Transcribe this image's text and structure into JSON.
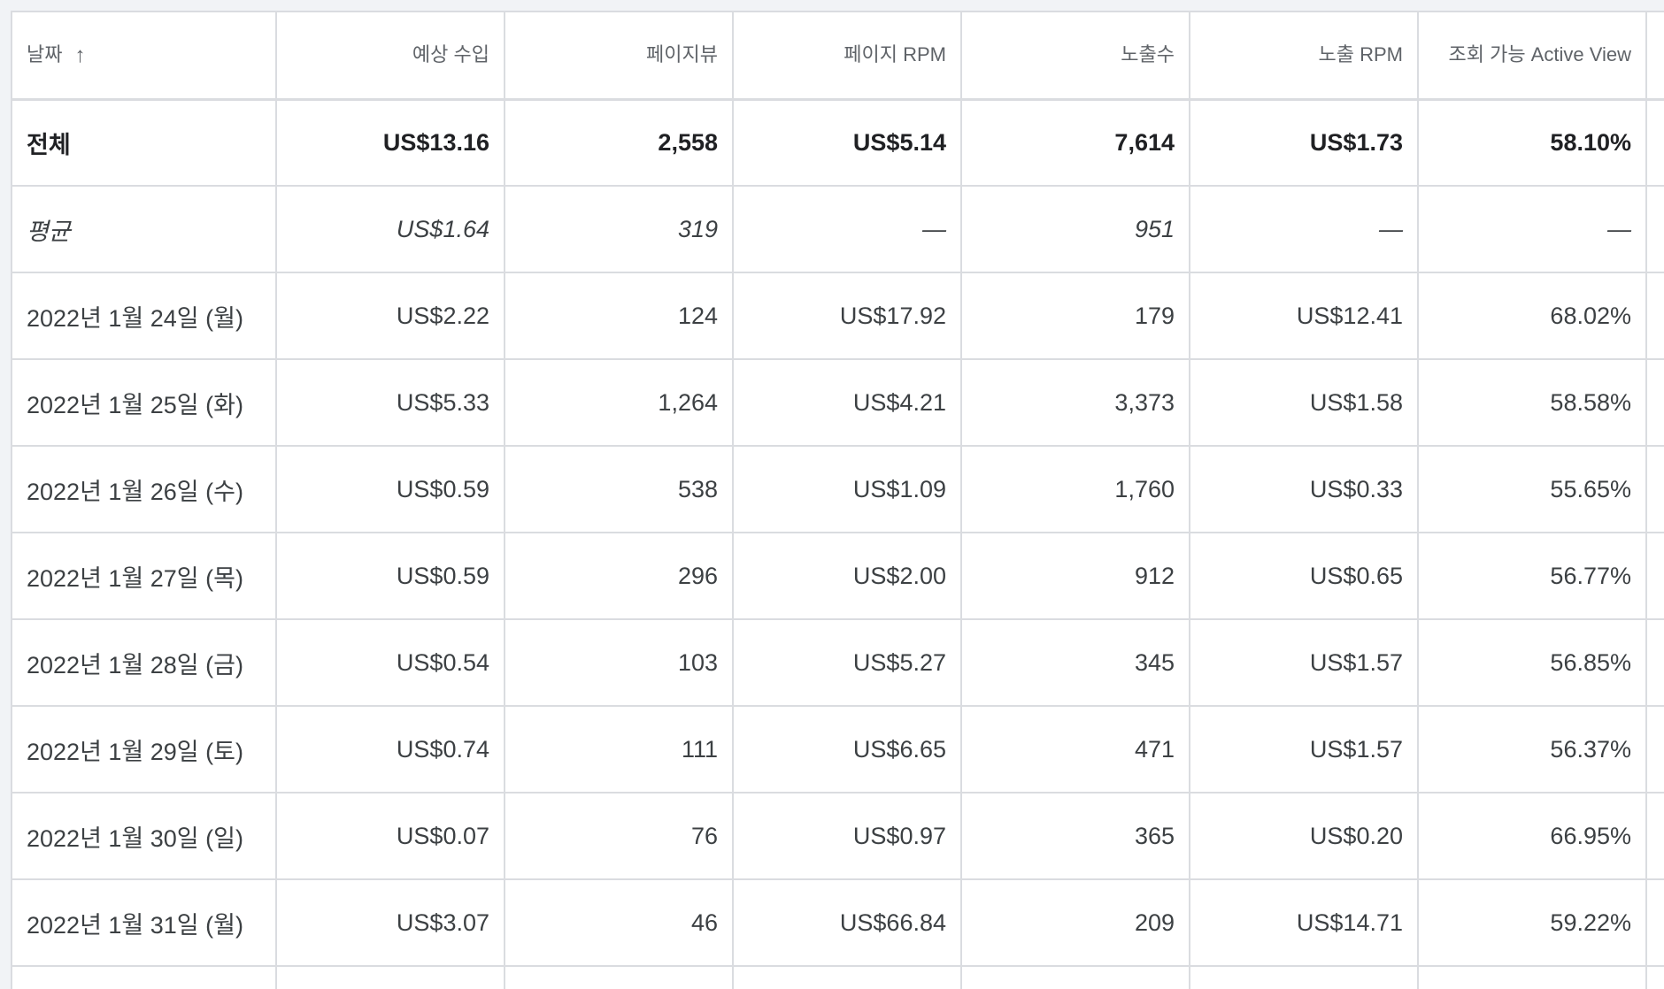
{
  "columns": [
    {
      "key": "date",
      "label": "날짜",
      "sorted": "asc",
      "sort_icon": "arrow-up-icon",
      "sort_glyph": "↑"
    },
    {
      "key": "revenue",
      "label": "예상 수입"
    },
    {
      "key": "pageviews",
      "label": "페이지뷰"
    },
    {
      "key": "page_rpm",
      "label": "페이지 RPM"
    },
    {
      "key": "impressions",
      "label": "노출수"
    },
    {
      "key": "impression_rpm",
      "label": "노출 RPM"
    },
    {
      "key": "active_view",
      "label": "조회 가능 Active View"
    }
  ],
  "total": {
    "date": "전체",
    "revenue": "US$13.16",
    "pageviews": "2,558",
    "page_rpm": "US$5.14",
    "impressions": "7,614",
    "impression_rpm": "US$1.73",
    "active_view": "58.10%"
  },
  "average": {
    "date": "평균",
    "revenue": "US$1.64",
    "pageviews": "319",
    "page_rpm": "—",
    "impressions": "951",
    "impression_rpm": "—",
    "active_view": "—"
  },
  "rows": [
    {
      "date": "2022년 1월 24일 (월)",
      "revenue": "US$2.22",
      "pageviews": "124",
      "page_rpm": "US$17.92",
      "impressions": "179",
      "impression_rpm": "US$12.41",
      "active_view": "68.02%"
    },
    {
      "date": "2022년 1월 25일 (화)",
      "revenue": "US$5.33",
      "pageviews": "1,264",
      "page_rpm": "US$4.21",
      "impressions": "3,373",
      "impression_rpm": "US$1.58",
      "active_view": "58.58%"
    },
    {
      "date": "2022년 1월 26일 (수)",
      "revenue": "US$0.59",
      "pageviews": "538",
      "page_rpm": "US$1.09",
      "impressions": "1,760",
      "impression_rpm": "US$0.33",
      "active_view": "55.65%"
    },
    {
      "date": "2022년 1월 27일 (목)",
      "revenue": "US$0.59",
      "pageviews": "296",
      "page_rpm": "US$2.00",
      "impressions": "912",
      "impression_rpm": "US$0.65",
      "active_view": "56.77%"
    },
    {
      "date": "2022년 1월 28일 (금)",
      "revenue": "US$0.54",
      "pageviews": "103",
      "page_rpm": "US$5.27",
      "impressions": "345",
      "impression_rpm": "US$1.57",
      "active_view": "56.85%"
    },
    {
      "date": "2022년 1월 29일 (토)",
      "revenue": "US$0.74",
      "pageviews": "111",
      "page_rpm": "US$6.65",
      "impressions": "471",
      "impression_rpm": "US$1.57",
      "active_view": "56.37%"
    },
    {
      "date": "2022년 1월 30일 (일)",
      "revenue": "US$0.07",
      "pageviews": "76",
      "page_rpm": "US$0.97",
      "impressions": "365",
      "impression_rpm": "US$0.20",
      "active_view": "66.95%"
    },
    {
      "date": "2022년 1월 31일 (월)",
      "revenue": "US$3.07",
      "pageviews": "46",
      "page_rpm": "US$66.84",
      "impressions": "209",
      "impression_rpm": "US$14.71",
      "active_view": "59.22%"
    }
  ]
}
